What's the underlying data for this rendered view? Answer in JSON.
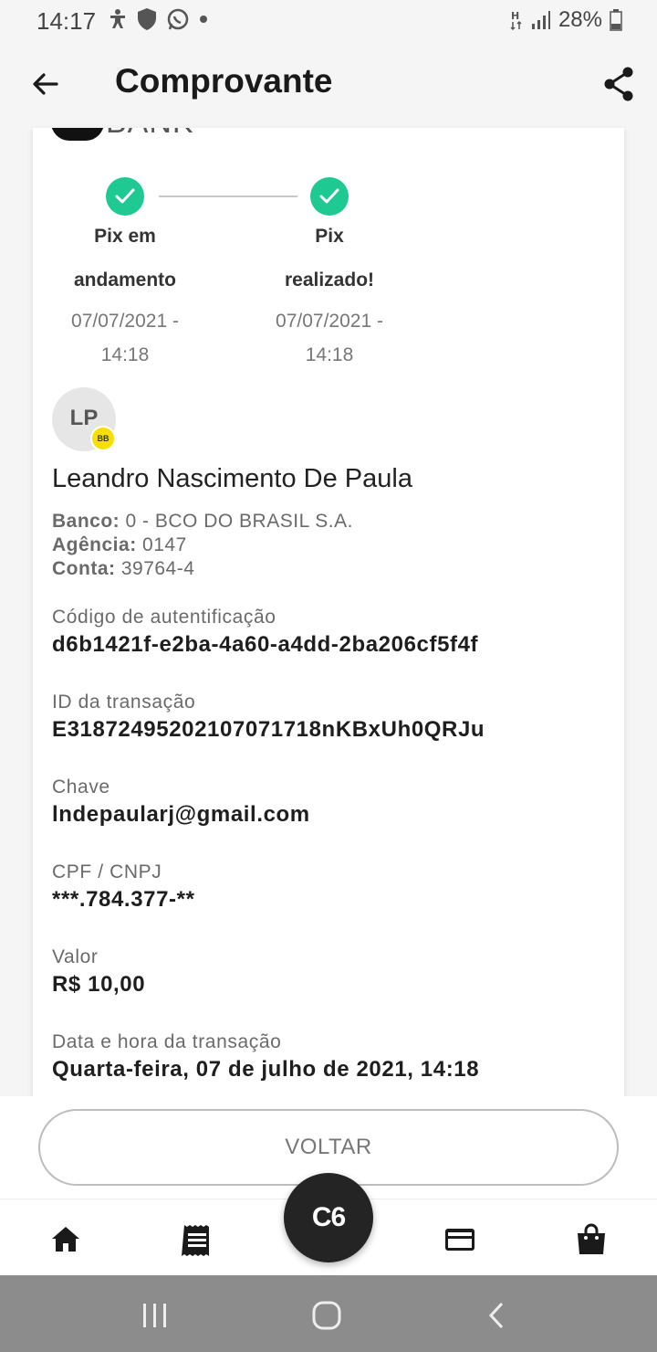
{
  "status_bar": {
    "time": "14:17",
    "battery": "28%",
    "icons": [
      "accessibility-icon",
      "shield-icon",
      "whatsapp-icon",
      "dot-icon",
      "network-h-icon",
      "signal-icon",
      "battery-icon"
    ]
  },
  "app_bar": {
    "title": "Comprovante",
    "back_icon": "arrow-left-icon",
    "share_icon": "share-icon"
  },
  "receipt": {
    "logo_text": "BANK",
    "steps": [
      {
        "label_line1": "Pix em",
        "label_line2": "andamento",
        "date_line1": "07/07/2021 -",
        "date_line2": "14:18",
        "icon": "check-icon"
      },
      {
        "label_line1": "Pix",
        "label_line2": "realizado!",
        "date_line1": "07/07/2021 -",
        "date_line2": "14:18",
        "icon": "check-icon"
      }
    ],
    "recipient": {
      "initials": "LP",
      "bank_badge": "BB",
      "name": "Leandro Nascimento De Paula",
      "banco_label": "Banco:",
      "banco_value": "0 - BCO DO BRASIL S.A.",
      "agencia_label": "Agência:",
      "agencia_value": "0147",
      "conta_label": "Conta:",
      "conta_value": "39764-4"
    },
    "fields": [
      {
        "label": "Código de autentificação",
        "value": "d6b1421f-e2ba-4a60-a4dd-2ba206cf5f4f"
      },
      {
        "label": "ID da transação",
        "value": "E31872495202107071718nKBxUh0QRJu"
      },
      {
        "label": "Chave",
        "value": "lndepaularj@gmail.com"
      },
      {
        "label": "CPF / CNPJ",
        "value": "***.784.377-**"
      },
      {
        "label": "Valor",
        "value": "R$ 10,00"
      },
      {
        "label": "Data e hora da transação",
        "value": "Quarta-feira, 07 de julho de 2021, 14:18"
      }
    ]
  },
  "actions": {
    "voltar_label": "VOLTAR"
  },
  "bottom_nav": {
    "fab_label": "C6",
    "items": [
      "home-icon",
      "statement-icon",
      "card-icon",
      "shopping-bag-icon"
    ]
  },
  "system_nav": [
    "recents-icon",
    "home-circle-icon",
    "back-chevron-icon"
  ]
}
